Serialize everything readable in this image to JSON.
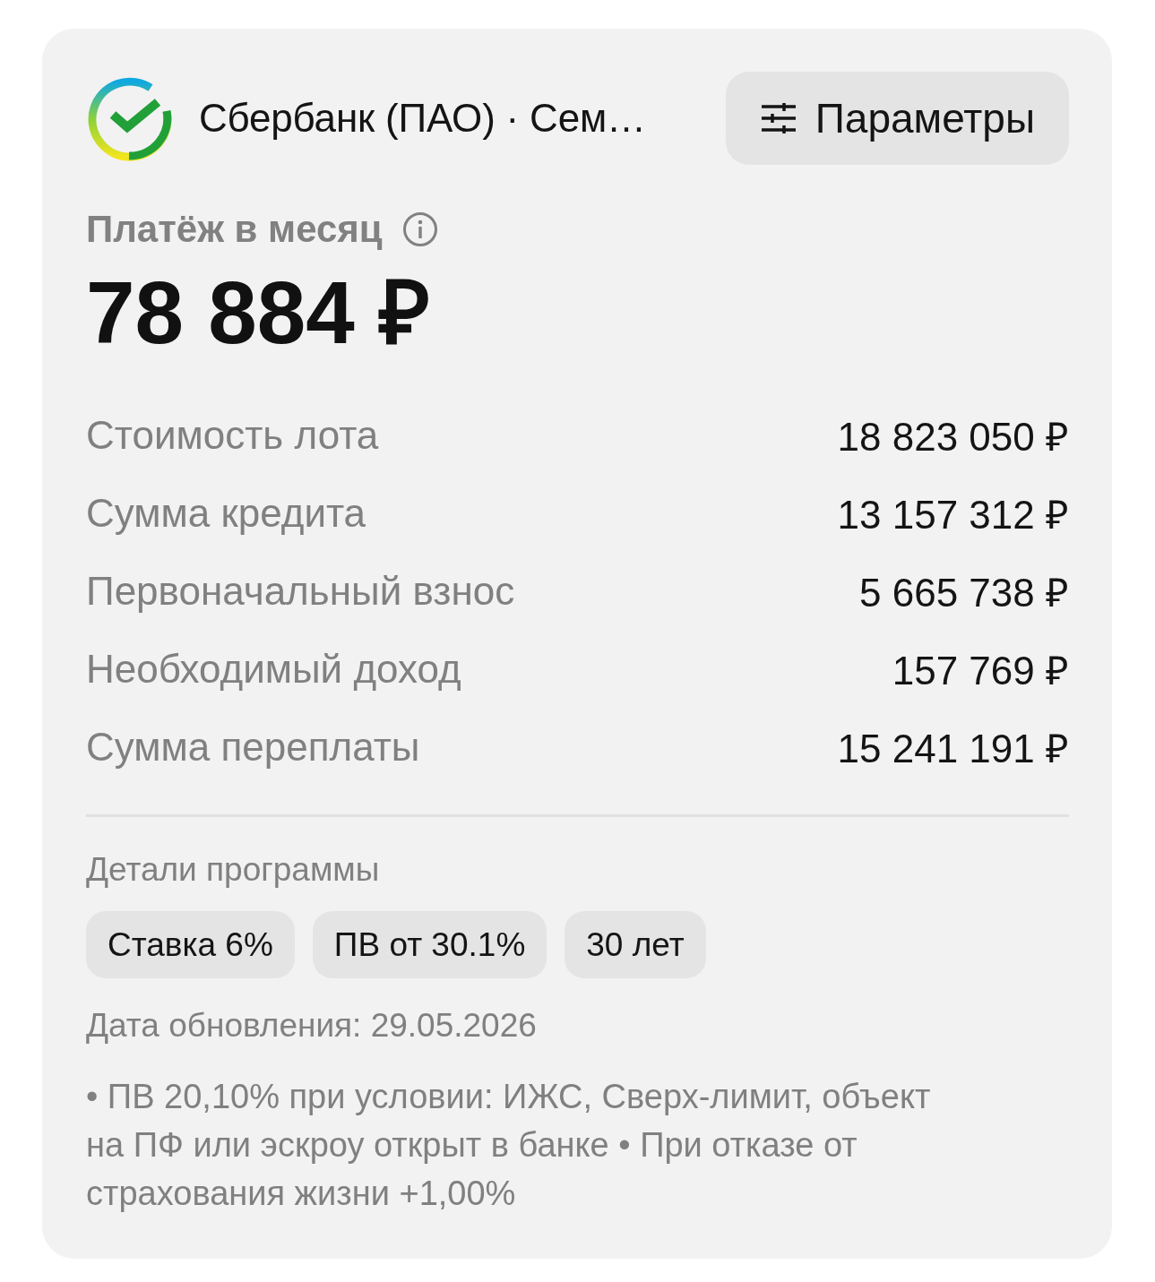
{
  "header": {
    "title": "Сбербанк (ПАО) · Сем…",
    "button": "Параметры"
  },
  "payment": {
    "label": "Платёж в месяц",
    "amount": "78 884 ₽"
  },
  "rows": [
    {
      "label": "Стоимость лота",
      "value": "18 823 050 ₽"
    },
    {
      "label": "Сумма кредита",
      "value": "13 157 312 ₽"
    },
    {
      "label": "Первоначальный взнос",
      "value": "5 665 738 ₽"
    },
    {
      "label": "Необходимый доход",
      "value": "157 769 ₽"
    },
    {
      "label": "Сумма переплаты",
      "value": "15 241 191 ₽"
    }
  ],
  "program": {
    "title": "Детали программы",
    "tags": [
      "Ставка 6%",
      "ПВ от 30.1%",
      "30 лет"
    ]
  },
  "updated": "Дата обновления: 29.05.2026",
  "note": "• ПВ 20,10% при условии: ИЖС, Сверх-лимит, объект на ПФ или эскроу открыт в банке • При отказе от страхования жизни +1,00%"
}
